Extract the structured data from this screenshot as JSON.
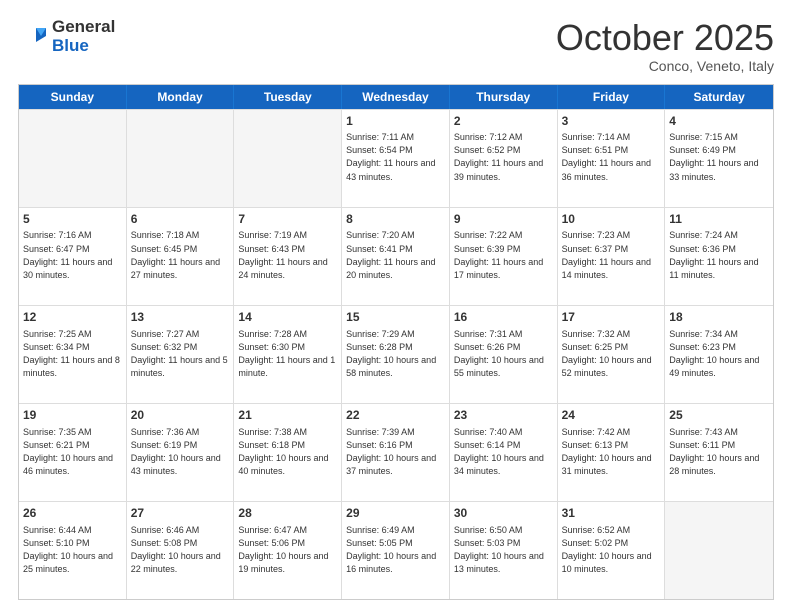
{
  "logo": {
    "general": "General",
    "blue": "Blue"
  },
  "header": {
    "month": "October 2025",
    "location": "Conco, Veneto, Italy"
  },
  "days": [
    "Sunday",
    "Monday",
    "Tuesday",
    "Wednesday",
    "Thursday",
    "Friday",
    "Saturday"
  ],
  "weeks": [
    [
      {
        "day": "",
        "info": ""
      },
      {
        "day": "",
        "info": ""
      },
      {
        "day": "",
        "info": ""
      },
      {
        "day": "1",
        "info": "Sunrise: 7:11 AM\nSunset: 6:54 PM\nDaylight: 11 hours and 43 minutes."
      },
      {
        "day": "2",
        "info": "Sunrise: 7:12 AM\nSunset: 6:52 PM\nDaylight: 11 hours and 39 minutes."
      },
      {
        "day": "3",
        "info": "Sunrise: 7:14 AM\nSunset: 6:51 PM\nDaylight: 11 hours and 36 minutes."
      },
      {
        "day": "4",
        "info": "Sunrise: 7:15 AM\nSunset: 6:49 PM\nDaylight: 11 hours and 33 minutes."
      }
    ],
    [
      {
        "day": "5",
        "info": "Sunrise: 7:16 AM\nSunset: 6:47 PM\nDaylight: 11 hours and 30 minutes."
      },
      {
        "day": "6",
        "info": "Sunrise: 7:18 AM\nSunset: 6:45 PM\nDaylight: 11 hours and 27 minutes."
      },
      {
        "day": "7",
        "info": "Sunrise: 7:19 AM\nSunset: 6:43 PM\nDaylight: 11 hours and 24 minutes."
      },
      {
        "day": "8",
        "info": "Sunrise: 7:20 AM\nSunset: 6:41 PM\nDaylight: 11 hours and 20 minutes."
      },
      {
        "day": "9",
        "info": "Sunrise: 7:22 AM\nSunset: 6:39 PM\nDaylight: 11 hours and 17 minutes."
      },
      {
        "day": "10",
        "info": "Sunrise: 7:23 AM\nSunset: 6:37 PM\nDaylight: 11 hours and 14 minutes."
      },
      {
        "day": "11",
        "info": "Sunrise: 7:24 AM\nSunset: 6:36 PM\nDaylight: 11 hours and 11 minutes."
      }
    ],
    [
      {
        "day": "12",
        "info": "Sunrise: 7:25 AM\nSunset: 6:34 PM\nDaylight: 11 hours and 8 minutes."
      },
      {
        "day": "13",
        "info": "Sunrise: 7:27 AM\nSunset: 6:32 PM\nDaylight: 11 hours and 5 minutes."
      },
      {
        "day": "14",
        "info": "Sunrise: 7:28 AM\nSunset: 6:30 PM\nDaylight: 11 hours and 1 minute."
      },
      {
        "day": "15",
        "info": "Sunrise: 7:29 AM\nSunset: 6:28 PM\nDaylight: 10 hours and 58 minutes."
      },
      {
        "day": "16",
        "info": "Sunrise: 7:31 AM\nSunset: 6:26 PM\nDaylight: 10 hours and 55 minutes."
      },
      {
        "day": "17",
        "info": "Sunrise: 7:32 AM\nSunset: 6:25 PM\nDaylight: 10 hours and 52 minutes."
      },
      {
        "day": "18",
        "info": "Sunrise: 7:34 AM\nSunset: 6:23 PM\nDaylight: 10 hours and 49 minutes."
      }
    ],
    [
      {
        "day": "19",
        "info": "Sunrise: 7:35 AM\nSunset: 6:21 PM\nDaylight: 10 hours and 46 minutes."
      },
      {
        "day": "20",
        "info": "Sunrise: 7:36 AM\nSunset: 6:19 PM\nDaylight: 10 hours and 43 minutes."
      },
      {
        "day": "21",
        "info": "Sunrise: 7:38 AM\nSunset: 6:18 PM\nDaylight: 10 hours and 40 minutes."
      },
      {
        "day": "22",
        "info": "Sunrise: 7:39 AM\nSunset: 6:16 PM\nDaylight: 10 hours and 37 minutes."
      },
      {
        "day": "23",
        "info": "Sunrise: 7:40 AM\nSunset: 6:14 PM\nDaylight: 10 hours and 34 minutes."
      },
      {
        "day": "24",
        "info": "Sunrise: 7:42 AM\nSunset: 6:13 PM\nDaylight: 10 hours and 31 minutes."
      },
      {
        "day": "25",
        "info": "Sunrise: 7:43 AM\nSunset: 6:11 PM\nDaylight: 10 hours and 28 minutes."
      }
    ],
    [
      {
        "day": "26",
        "info": "Sunrise: 6:44 AM\nSunset: 5:10 PM\nDaylight: 10 hours and 25 minutes."
      },
      {
        "day": "27",
        "info": "Sunrise: 6:46 AM\nSunset: 5:08 PM\nDaylight: 10 hours and 22 minutes."
      },
      {
        "day": "28",
        "info": "Sunrise: 6:47 AM\nSunset: 5:06 PM\nDaylight: 10 hours and 19 minutes."
      },
      {
        "day": "29",
        "info": "Sunrise: 6:49 AM\nSunset: 5:05 PM\nDaylight: 10 hours and 16 minutes."
      },
      {
        "day": "30",
        "info": "Sunrise: 6:50 AM\nSunset: 5:03 PM\nDaylight: 10 hours and 13 minutes."
      },
      {
        "day": "31",
        "info": "Sunrise: 6:52 AM\nSunset: 5:02 PM\nDaylight: 10 hours and 10 minutes."
      },
      {
        "day": "",
        "info": ""
      }
    ]
  ]
}
